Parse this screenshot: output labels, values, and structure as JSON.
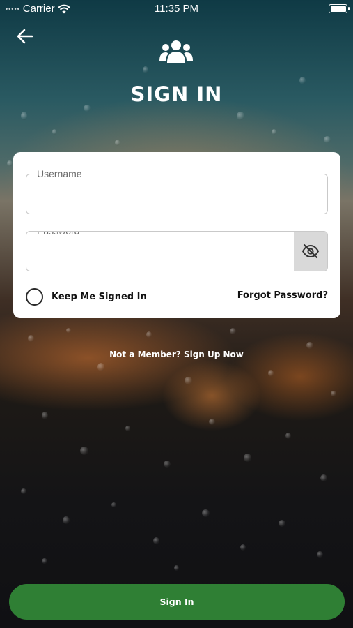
{
  "status_bar": {
    "carrier": "Carrier",
    "time": "11:35 PM",
    "icons": [
      "signal-dots-icon",
      "wifi-icon",
      "battery-icon"
    ]
  },
  "header": {
    "back_icon": "arrow-left-icon",
    "logo_icon": "users-group-icon",
    "title": "SIGN IN"
  },
  "form": {
    "username": {
      "label": "Username",
      "value": ""
    },
    "password": {
      "label": "Password",
      "value": "",
      "toggle_icon": "eye-off-icon"
    },
    "keep_signed_in": {
      "label": "Keep Me Signed In",
      "checked": false
    },
    "forgot_password": "Forgot Password?"
  },
  "signup_link": "Not a Member? Sign Up Now",
  "signin_button": "Sign In",
  "colors": {
    "primary_button": "#2f7f34",
    "card_bg": "#ffffff",
    "text_dark": "#111111"
  }
}
